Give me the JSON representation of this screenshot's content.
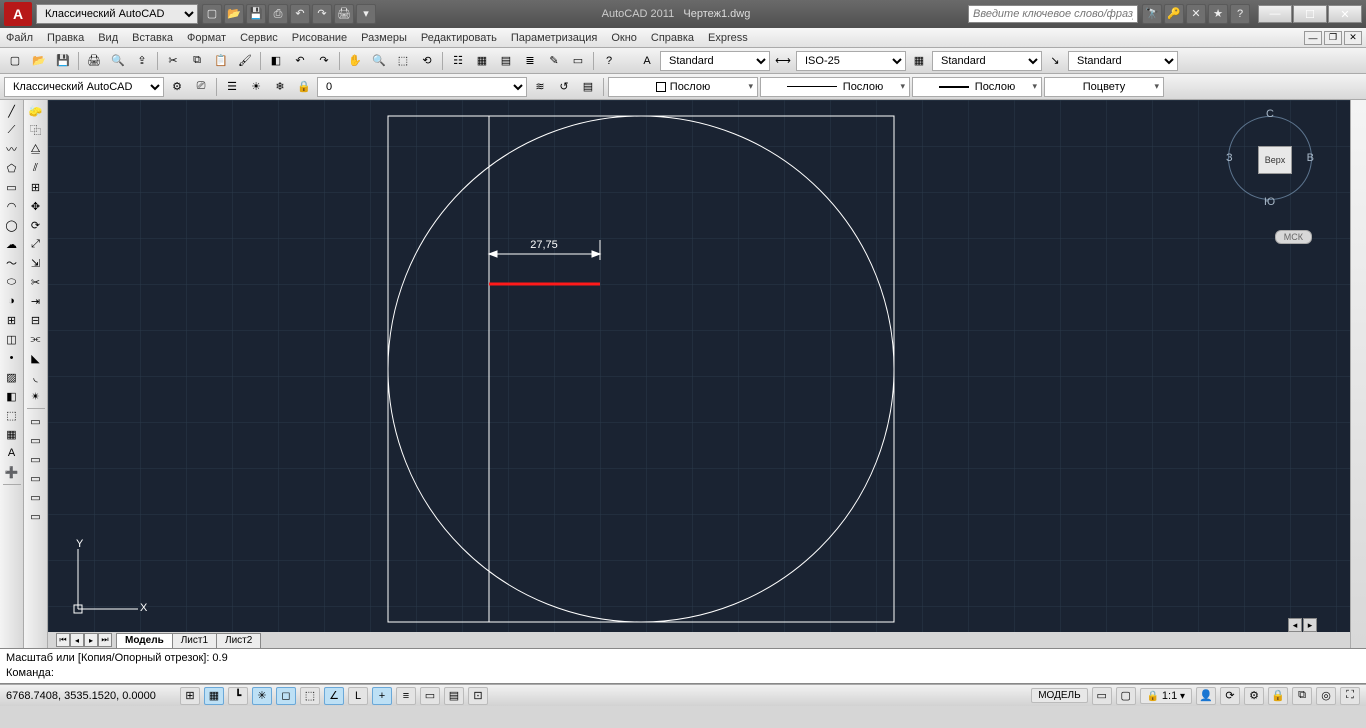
{
  "title": {
    "app": "AutoCAD 2011",
    "doc": "Чертеж1.dwg"
  },
  "workspace": "Классический AutoCAD",
  "search_placeholder": "Введите ключевое слово/фразу",
  "menu": [
    "Файл",
    "Правка",
    "Вид",
    "Вставка",
    "Формат",
    "Сервис",
    "Рисование",
    "Размеры",
    "Редактировать",
    "Параметризация",
    "Окно",
    "Справка",
    "Express"
  ],
  "topToolbar2": {
    "workspace": "Классический AutoCAD",
    "layer": "0"
  },
  "stylebar": {
    "textstyle": "Standard",
    "dimstyle": "ISO-25",
    "tablestyle": "Standard",
    "mleaderstyle": "Standard"
  },
  "propsbar": {
    "color": "Послою",
    "linetype": "Послою",
    "lineweight": "Послою",
    "plotstyle": "Поцвету"
  },
  "viewcube": {
    "top": "С",
    "bottom": "Ю",
    "left": "З",
    "right": "В",
    "face": "Верх",
    "coord": "МСК"
  },
  "dimension": {
    "value": "27,75"
  },
  "tabs": {
    "active": "Модель",
    "others": [
      "Лист1",
      "Лист2"
    ]
  },
  "command": {
    "line1": "Масштаб или [Копия/Опорный отрезок]: 0.9",
    "line2": "Команда:"
  },
  "status": {
    "coords": "6768.7408, 3535.1520, 0.0000",
    "model": "МОДЕЛЬ",
    "scale": "1:1"
  },
  "wc": {
    "min": "—",
    "max": "☐",
    "close": "✕"
  }
}
